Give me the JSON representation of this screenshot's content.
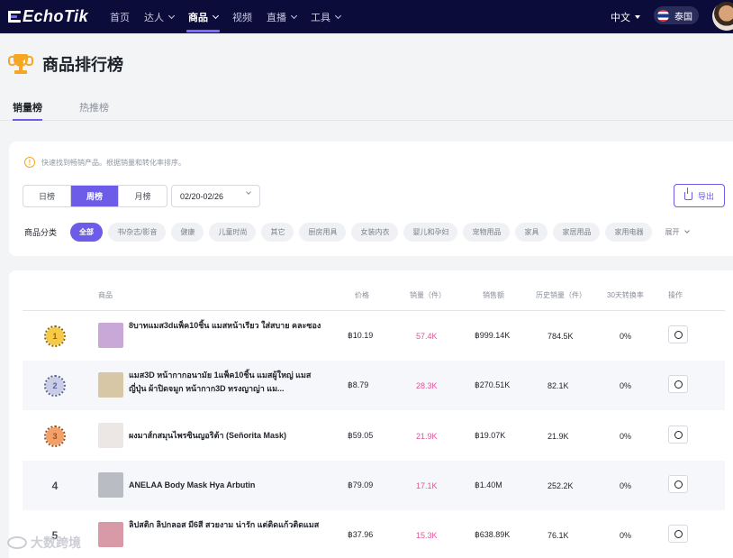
{
  "app": {
    "logo": "EchoTik"
  },
  "nav": {
    "items": [
      {
        "label": "首页",
        "dropdown": false,
        "active": false
      },
      {
        "label": "达人",
        "dropdown": true,
        "active": false
      },
      {
        "label": "商品",
        "dropdown": true,
        "active": true
      },
      {
        "label": "视频",
        "dropdown": false,
        "active": false
      },
      {
        "label": "直播",
        "dropdown": true,
        "active": false
      },
      {
        "label": "工具",
        "dropdown": true,
        "active": false
      }
    ],
    "language": "中文",
    "region": "泰国"
  },
  "page": {
    "title": "商品排行榜",
    "tabs": [
      {
        "label": "销量榜",
        "active": true
      },
      {
        "label": "热推榜",
        "active": false
      }
    ]
  },
  "filters": {
    "tip": "快速找到畅销产品。根据销量和转化率排序。",
    "periods": [
      {
        "label": "日榜",
        "active": false
      },
      {
        "label": "周榜",
        "active": true
      },
      {
        "label": "月榜",
        "active": false
      }
    ],
    "date_range": "02/20-02/26",
    "export_label": "导出",
    "category_label": "商品分类",
    "categories": [
      {
        "label": "全部",
        "active": true
      },
      {
        "label": "书/杂志/影音",
        "active": false
      },
      {
        "label": "健康",
        "active": false
      },
      {
        "label": "儿童时尚",
        "active": false
      },
      {
        "label": "其它",
        "active": false
      },
      {
        "label": "厨房用具",
        "active": false
      },
      {
        "label": "女装内衣",
        "active": false
      },
      {
        "label": "婴儿和孕妇",
        "active": false
      },
      {
        "label": "宠物用品",
        "active": false
      },
      {
        "label": "家具",
        "active": false
      },
      {
        "label": "家居用品",
        "active": false
      },
      {
        "label": "家用电器",
        "active": false
      }
    ],
    "expand_label": "展开"
  },
  "table": {
    "columns": [
      "商品",
      "价格",
      "销量（件）",
      "销售额",
      "历史销量（件）",
      "30天转换率",
      "操作"
    ],
    "rows": [
      {
        "rank": "1",
        "name": "8บาทแมส3dแพ็ค10ชิ้น แมสหน้าเรียว ใส่สบาย คละซอง",
        "price": "฿10.19",
        "sales": "57.4K",
        "revenue": "฿999.14K",
        "total_sales": "784.5K",
        "conversion": "0%",
        "thumb_color": "#c9a8d8"
      },
      {
        "rank": "2",
        "name": "แมส3D หน้ากากอนามัย 1แพ็ค10ชิ้น แมสผู้ใหญ่ แมสญี่ปุ่น ผ้าปิดจมูก หน้ากาก3D ทรงญาญ่า แม...",
        "price": "฿8.79",
        "sales": "28.3K",
        "revenue": "฿270.51K",
        "total_sales": "82.1K",
        "conversion": "0%",
        "thumb_color": "#d8c7a6"
      },
      {
        "rank": "3",
        "name": "ผงมาส์กสมุนไพรซินญอริต้า (Señorita Mask)",
        "price": "฿59.05",
        "sales": "21.9K",
        "revenue": "฿19.07K",
        "total_sales": "21.9K",
        "conversion": "0%",
        "thumb_color": "#ece6e4"
      },
      {
        "rank": "4",
        "name": "ANELAA Body Mask Hya Arbutin",
        "price": "฿79.09",
        "sales": "17.1K",
        "revenue": "฿1.40M",
        "total_sales": "252.2K",
        "conversion": "0%",
        "thumb_color": "#b9bcc2"
      },
      {
        "rank": "5",
        "name": "ลิปสติก ลิปกลอส มี6สี สวยงาม น่ารัก แต่ติดแก้วติดแมส",
        "price": "฿37.96",
        "sales": "15.3K",
        "revenue": "฿638.89K",
        "total_sales": "76.1K",
        "conversion": "0%",
        "thumb_color": "#d99aa8"
      }
    ]
  },
  "watermark": "大数跨境"
}
